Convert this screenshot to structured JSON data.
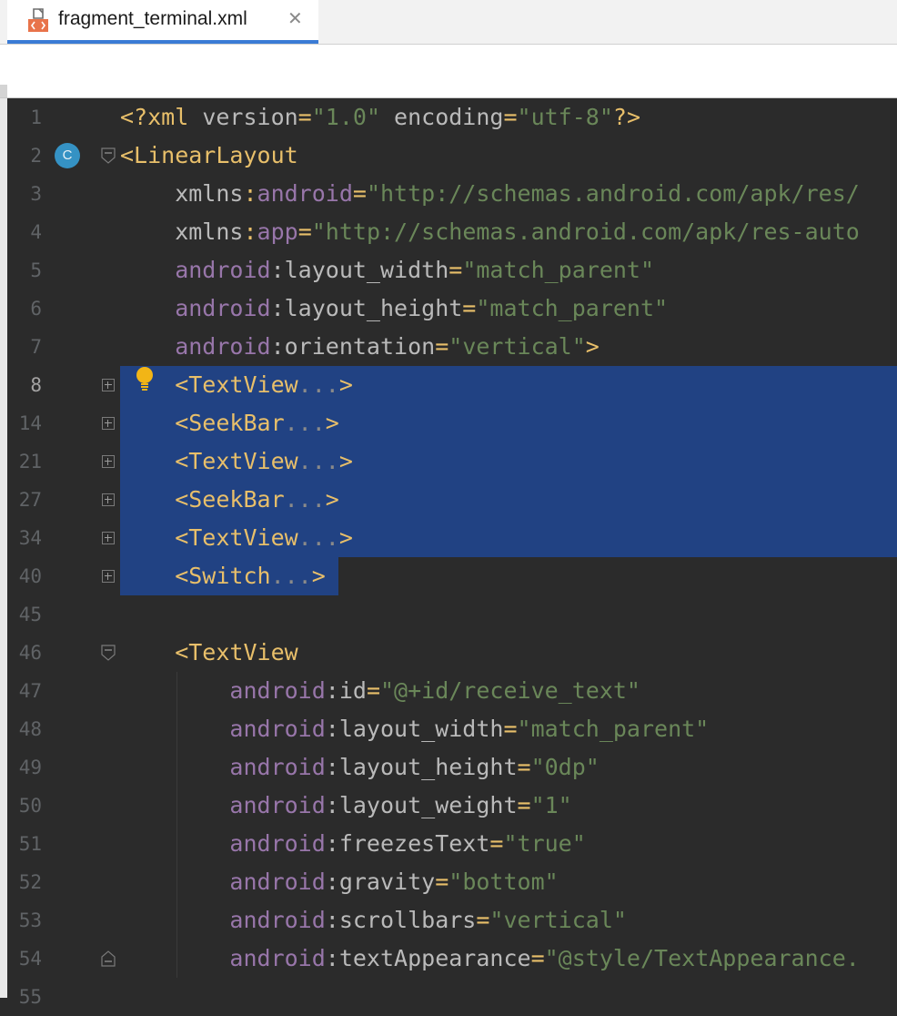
{
  "tab": {
    "title": "fragment_terminal.xml",
    "close_glyph": "✕",
    "file_icon": "xml-file-icon"
  },
  "gutter": {
    "class_marker": "C",
    "current_line": "8"
  },
  "lines": [
    {
      "num": "1",
      "parts": [
        [
          "tag",
          "<?xml "
        ],
        [
          "attr",
          "version"
        ],
        [
          "tag",
          "="
        ],
        [
          "val",
          "\"1.0\""
        ],
        [
          "attr",
          " encoding"
        ],
        [
          "tag",
          "="
        ],
        [
          "val",
          "\"utf-8\""
        ],
        [
          "tag",
          "?>"
        ]
      ]
    },
    {
      "num": "2",
      "parts": [
        [
          "tag",
          "<LinearLayout"
        ]
      ]
    },
    {
      "num": "3",
      "parts": [
        [
          "attr",
          "    xmlns"
        ],
        [
          "tag",
          ":"
        ],
        [
          "ns",
          "android"
        ],
        [
          "tag",
          "="
        ],
        [
          "val",
          "\"http://schemas.android.com/apk/res/"
        ]
      ]
    },
    {
      "num": "4",
      "parts": [
        [
          "attr",
          "    xmlns"
        ],
        [
          "tag",
          ":"
        ],
        [
          "ns",
          "app"
        ],
        [
          "tag",
          "="
        ],
        [
          "val",
          "\"http://schemas.android.com/apk/res-auto"
        ]
      ]
    },
    {
      "num": "5",
      "parts": [
        [
          "ns",
          "    android"
        ],
        [
          "attr",
          ":layout_width"
        ],
        [
          "tag",
          "="
        ],
        [
          "val",
          "\"match_parent\""
        ]
      ]
    },
    {
      "num": "6",
      "parts": [
        [
          "ns",
          "    android"
        ],
        [
          "attr",
          ":layout_height"
        ],
        [
          "tag",
          "="
        ],
        [
          "val",
          "\"match_parent\""
        ]
      ]
    },
    {
      "num": "7",
      "parts": [
        [
          "ns",
          "    android"
        ],
        [
          "attr",
          ":orientation"
        ],
        [
          "tag",
          "="
        ],
        [
          "val",
          "\"vertical\""
        ],
        [
          "tag",
          ">"
        ]
      ]
    },
    {
      "num": "8",
      "parts": [
        [
          "tag",
          "    <TextView"
        ],
        [
          "fold-dim",
          "..."
        ],
        [
          "tag",
          ">"
        ]
      ]
    },
    {
      "num": "14",
      "parts": [
        [
          "tag",
          "    <SeekBar"
        ],
        [
          "fold-dim",
          "..."
        ],
        [
          "tag",
          ">"
        ]
      ]
    },
    {
      "num": "21",
      "parts": [
        [
          "tag",
          "    <TextView"
        ],
        [
          "fold-dim",
          "..."
        ],
        [
          "tag",
          ">"
        ]
      ]
    },
    {
      "num": "27",
      "parts": [
        [
          "tag",
          "    <SeekBar"
        ],
        [
          "fold-dim",
          "..."
        ],
        [
          "tag",
          ">"
        ]
      ]
    },
    {
      "num": "34",
      "parts": [
        [
          "tag",
          "    <TextView"
        ],
        [
          "fold-dim",
          "..."
        ],
        [
          "tag",
          ">"
        ]
      ]
    },
    {
      "num": "40",
      "parts": [
        [
          "tag",
          "    <Switch"
        ],
        [
          "fold-dim",
          "..."
        ],
        [
          "tag",
          ">"
        ]
      ]
    },
    {
      "num": "45",
      "parts": []
    },
    {
      "num": "46",
      "parts": [
        [
          "tag",
          "    <TextView"
        ]
      ]
    },
    {
      "num": "47",
      "parts": [
        [
          "ns",
          "        android"
        ],
        [
          "attr",
          ":id"
        ],
        [
          "tag",
          "="
        ],
        [
          "val",
          "\"@+id/receive_text\""
        ]
      ]
    },
    {
      "num": "48",
      "parts": [
        [
          "ns",
          "        android"
        ],
        [
          "attr",
          ":layout_width"
        ],
        [
          "tag",
          "="
        ],
        [
          "val",
          "\"match_parent\""
        ]
      ]
    },
    {
      "num": "49",
      "parts": [
        [
          "ns",
          "        android"
        ],
        [
          "attr",
          ":layout_height"
        ],
        [
          "tag",
          "="
        ],
        [
          "val",
          "\"0dp\""
        ]
      ]
    },
    {
      "num": "50",
      "parts": [
        [
          "ns",
          "        android"
        ],
        [
          "attr",
          ":layout_weight"
        ],
        [
          "tag",
          "="
        ],
        [
          "val",
          "\"1\""
        ]
      ]
    },
    {
      "num": "51",
      "parts": [
        [
          "ns",
          "        android"
        ],
        [
          "attr",
          ":freezesText"
        ],
        [
          "tag",
          "="
        ],
        [
          "val",
          "\"true\""
        ]
      ]
    },
    {
      "num": "52",
      "parts": [
        [
          "ns",
          "        android"
        ],
        [
          "attr",
          ":gravity"
        ],
        [
          "tag",
          "="
        ],
        [
          "val",
          "\"bottom\""
        ]
      ]
    },
    {
      "num": "53",
      "parts": [
        [
          "ns",
          "        android"
        ],
        [
          "attr",
          ":scrollbars"
        ],
        [
          "tag",
          "="
        ],
        [
          "val",
          "\"vertical\""
        ]
      ]
    },
    {
      "num": "54",
      "parts": [
        [
          "ns",
          "        android"
        ],
        [
          "attr",
          ":textAppearance"
        ],
        [
          "tag",
          "="
        ],
        [
          "val",
          "\"@style/TextAppearance."
        ]
      ]
    },
    {
      "num": "55",
      "parts": []
    }
  ],
  "colors": {
    "editor_bg": "#2b2b2b",
    "selection": "#214283",
    "tag": "#e8bf6a",
    "namespace": "#9876aa",
    "attribute": "#bababa",
    "value": "#6a8759",
    "line_number": "#606366"
  }
}
